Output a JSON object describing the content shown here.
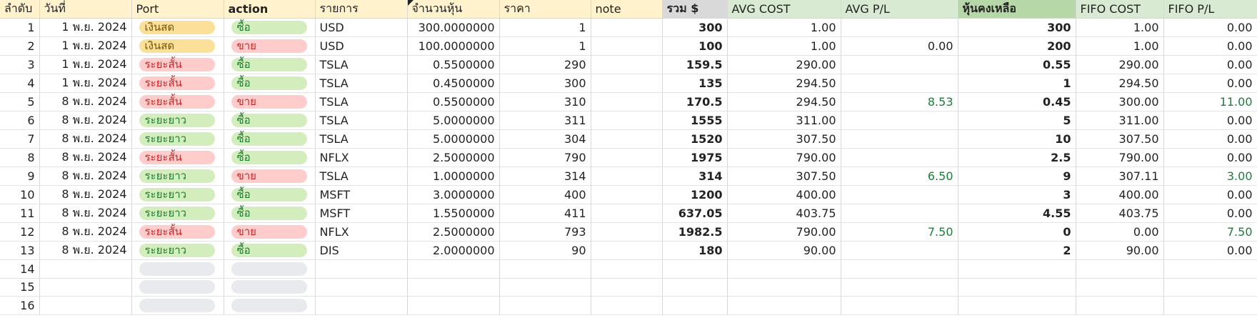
{
  "headers": [
    "ลำดับ",
    "วันที่",
    "Port",
    "action",
    "รายการ",
    "จำนวนหุ้น",
    "ราคา",
    "note",
    "รวม $",
    "AVG COST",
    "AVG P/L",
    "หุ้นคงเหลือ",
    "FIFO COST",
    "FIFO P/L"
  ],
  "colors": {
    "header_yellow": "#fff2cc",
    "header_green": "#d9ead3",
    "header_dark_green": "#b6d7a8",
    "header_gray": "#d9d9d9",
    "positive_green": "#188038"
  },
  "rows": [
    {
      "no": "1",
      "date": "1 พ.ย. 2024",
      "port": "เงินสด",
      "port_type": "cash",
      "action": "ซื้อ",
      "action_type": "buy",
      "item": "USD",
      "qty": "300.0000000",
      "price": "1",
      "note": "",
      "total": "300",
      "avg_cost": "1.00",
      "avg_pl": "",
      "avg_pl_pos": false,
      "remain": "300",
      "fifo_cost": "1.00",
      "fifo_pl": "0.00",
      "fifo_pl_pos": false
    },
    {
      "no": "2",
      "date": "1 พ.ย. 2024",
      "port": "เงินสด",
      "port_type": "cash",
      "action": "ขาย",
      "action_type": "sell",
      "item": "USD",
      "qty": "100.0000000",
      "price": "1",
      "note": "",
      "total": "100",
      "avg_cost": "1.00",
      "avg_pl": "0.00",
      "avg_pl_pos": false,
      "remain": "200",
      "fifo_cost": "1.00",
      "fifo_pl": "0.00",
      "fifo_pl_pos": false
    },
    {
      "no": "3",
      "date": "1 พ.ย. 2024",
      "port": "ระยะสั้น",
      "port_type": "short",
      "action": "ซื้อ",
      "action_type": "buy",
      "item": "TSLA",
      "qty": "0.5500000",
      "price": "290",
      "note": "",
      "total": "159.5",
      "avg_cost": "290.00",
      "avg_pl": "",
      "avg_pl_pos": false,
      "remain": "0.55",
      "fifo_cost": "290.00",
      "fifo_pl": "0.00",
      "fifo_pl_pos": false
    },
    {
      "no": "4",
      "date": "1 พ.ย. 2024",
      "port": "ระยะสั้น",
      "port_type": "short",
      "action": "ซื้อ",
      "action_type": "buy",
      "item": "TSLA",
      "qty": "0.4500000",
      "price": "300",
      "note": "",
      "total": "135",
      "avg_cost": "294.50",
      "avg_pl": "",
      "avg_pl_pos": false,
      "remain": "1",
      "fifo_cost": "294.50",
      "fifo_pl": "0.00",
      "fifo_pl_pos": false
    },
    {
      "no": "5",
      "date": "8 พ.ย. 2024",
      "port": "ระยะสั้น",
      "port_type": "short",
      "action": "ขาย",
      "action_type": "sell",
      "item": "TSLA",
      "qty": "0.5500000",
      "price": "310",
      "note": "",
      "total": "170.5",
      "avg_cost": "294.50",
      "avg_pl": "8.53",
      "avg_pl_pos": true,
      "remain": "0.45",
      "fifo_cost": "300.00",
      "fifo_pl": "11.00",
      "fifo_pl_pos": true
    },
    {
      "no": "6",
      "date": "8 พ.ย. 2024",
      "port": "ระยะยาว",
      "port_type": "long",
      "action": "ซื้อ",
      "action_type": "buy",
      "item": "TSLA",
      "qty": "5.0000000",
      "price": "311",
      "note": "",
      "total": "1555",
      "avg_cost": "311.00",
      "avg_pl": "",
      "avg_pl_pos": false,
      "remain": "5",
      "fifo_cost": "311.00",
      "fifo_pl": "0.00",
      "fifo_pl_pos": false
    },
    {
      "no": "7",
      "date": "8 พ.ย. 2024",
      "port": "ระยะยาว",
      "port_type": "long",
      "action": "ซื้อ",
      "action_type": "buy",
      "item": "TSLA",
      "qty": "5.0000000",
      "price": "304",
      "note": "",
      "total": "1520",
      "avg_cost": "307.50",
      "avg_pl": "",
      "avg_pl_pos": false,
      "remain": "10",
      "fifo_cost": "307.50",
      "fifo_pl": "0.00",
      "fifo_pl_pos": false
    },
    {
      "no": "8",
      "date": "8 พ.ย. 2024",
      "port": "ระยะสั้น",
      "port_type": "short",
      "action": "ซื้อ",
      "action_type": "buy",
      "item": "NFLX",
      "qty": "2.5000000",
      "price": "790",
      "note": "",
      "total": "1975",
      "avg_cost": "790.00",
      "avg_pl": "",
      "avg_pl_pos": false,
      "remain": "2.5",
      "fifo_cost": "790.00",
      "fifo_pl": "0.00",
      "fifo_pl_pos": false
    },
    {
      "no": "9",
      "date": "8 พ.ย. 2024",
      "port": "ระยะยาว",
      "port_type": "long",
      "action": "ขาย",
      "action_type": "sell",
      "item": "TSLA",
      "qty": "1.0000000",
      "price": "314",
      "note": "",
      "total": "314",
      "avg_cost": "307.50",
      "avg_pl": "6.50",
      "avg_pl_pos": true,
      "remain": "9",
      "fifo_cost": "307.11",
      "fifo_pl": "3.00",
      "fifo_pl_pos": true
    },
    {
      "no": "10",
      "date": "8 พ.ย. 2024",
      "port": "ระยะยาว",
      "port_type": "long",
      "action": "ซื้อ",
      "action_type": "buy",
      "item": "MSFT",
      "qty": "3.0000000",
      "price": "400",
      "note": "",
      "total": "1200",
      "avg_cost": "400.00",
      "avg_pl": "",
      "avg_pl_pos": false,
      "remain": "3",
      "fifo_cost": "400.00",
      "fifo_pl": "0.00",
      "fifo_pl_pos": false
    },
    {
      "no": "11",
      "date": "8 พ.ย. 2024",
      "port": "ระยะยาว",
      "port_type": "long",
      "action": "ซื้อ",
      "action_type": "buy",
      "item": "MSFT",
      "qty": "1.5500000",
      "price": "411",
      "note": "",
      "total": "637.05",
      "avg_cost": "403.75",
      "avg_pl": "",
      "avg_pl_pos": false,
      "remain": "4.55",
      "fifo_cost": "403.75",
      "fifo_pl": "0.00",
      "fifo_pl_pos": false
    },
    {
      "no": "12",
      "date": "8 พ.ย. 2024",
      "port": "ระยะสั้น",
      "port_type": "short",
      "action": "ขาย",
      "action_type": "sell",
      "item": "NFLX",
      "qty": "2.5000000",
      "price": "793",
      "note": "",
      "total": "1982.5",
      "avg_cost": "790.00",
      "avg_pl": "7.50",
      "avg_pl_pos": true,
      "remain": "0",
      "fifo_cost": "0.00",
      "fifo_pl": "7.50",
      "fifo_pl_pos": true
    },
    {
      "no": "13",
      "date": "8 พ.ย. 2024",
      "port": "ระยะยาว",
      "port_type": "long",
      "action": "ซื้อ",
      "action_type": "buy",
      "item": "DIS",
      "qty": "2.0000000",
      "price": "90",
      "note": "",
      "total": "180",
      "avg_cost": "90.00",
      "avg_pl": "",
      "avg_pl_pos": false,
      "remain": "2",
      "fifo_cost": "90.00",
      "fifo_pl": "0.00",
      "fifo_pl_pos": false
    },
    {
      "no": "14",
      "date": "",
      "port": "",
      "port_type": "empty",
      "action": "",
      "action_type": "empty",
      "item": "",
      "qty": "",
      "price": "",
      "note": "",
      "total": "",
      "avg_cost": "",
      "avg_pl": "",
      "avg_pl_pos": false,
      "remain": "",
      "fifo_cost": "",
      "fifo_pl": "",
      "fifo_pl_pos": false
    },
    {
      "no": "15",
      "date": "",
      "port": "",
      "port_type": "empty",
      "action": "",
      "action_type": "empty",
      "item": "",
      "qty": "",
      "price": "",
      "note": "",
      "total": "",
      "avg_cost": "",
      "avg_pl": "",
      "avg_pl_pos": false,
      "remain": "",
      "fifo_cost": "",
      "fifo_pl": "",
      "fifo_pl_pos": false
    },
    {
      "no": "16",
      "date": "",
      "port": "",
      "port_type": "empty",
      "action": "",
      "action_type": "empty",
      "item": "",
      "qty": "",
      "price": "",
      "note": "",
      "total": "",
      "avg_cost": "",
      "avg_pl": "",
      "avg_pl_pos": false,
      "remain": "",
      "fifo_cost": "",
      "fifo_pl": "",
      "fifo_pl_pos": false
    }
  ]
}
